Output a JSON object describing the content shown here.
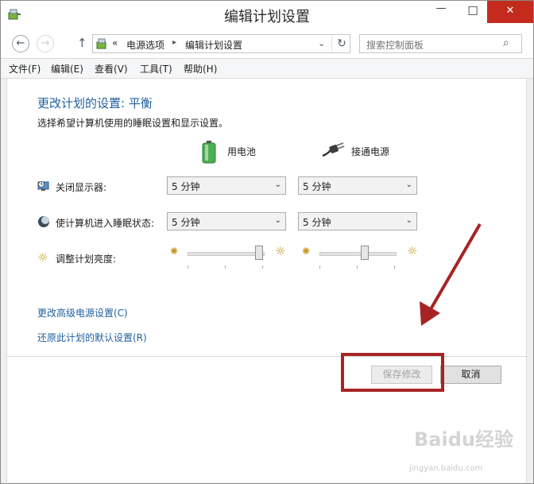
{
  "window": {
    "title": "编辑计划设置",
    "buttons": {
      "minimize": "—",
      "maximize": "☐",
      "close": "✕"
    }
  },
  "nav": {
    "back": "←",
    "forward": "→",
    "up": "↑",
    "address": {
      "chevron": "«",
      "segments": [
        "电源选项",
        "编辑计划设置"
      ],
      "separator": "▸",
      "dropdown": "⌄",
      "refresh": "↻"
    },
    "search": {
      "placeholder": "搜索控制面板",
      "icon": "⌕"
    }
  },
  "menubar": [
    "文件(F)",
    "编辑(E)",
    "查看(V)",
    "工具(T)",
    "帮助(H)"
  ],
  "content": {
    "heading": "更改计划的设置: 平衡",
    "description": "选择希望计算机使用的睡眠设置和显示设置。",
    "columns": {
      "battery": "用电池",
      "plugged": "接通电源"
    },
    "rows": {
      "display": {
        "label": "关闭显示器:",
        "battery_value": "5 分钟",
        "plugged_value": "5 分钟"
      },
      "sleep": {
        "label": "使计算机进入睡眠状态:",
        "battery_value": "5 分钟",
        "plugged_value": "5 分钟"
      },
      "brightness": {
        "label": "调整计划亮度:",
        "battery_level": 0.95,
        "plugged_level": 0.6
      }
    },
    "links": {
      "advanced": "更改高级电源设置(C)",
      "restore": "还原此计划的默认设置(R)"
    },
    "buttons": {
      "save": "保存修改",
      "cancel": "取消"
    },
    "dropdown_arrow": "⌄"
  },
  "annotation": {
    "color": "#a82424"
  },
  "watermark": {
    "logo": "Baidu经验",
    "url": "jingyan.baidu.com"
  }
}
